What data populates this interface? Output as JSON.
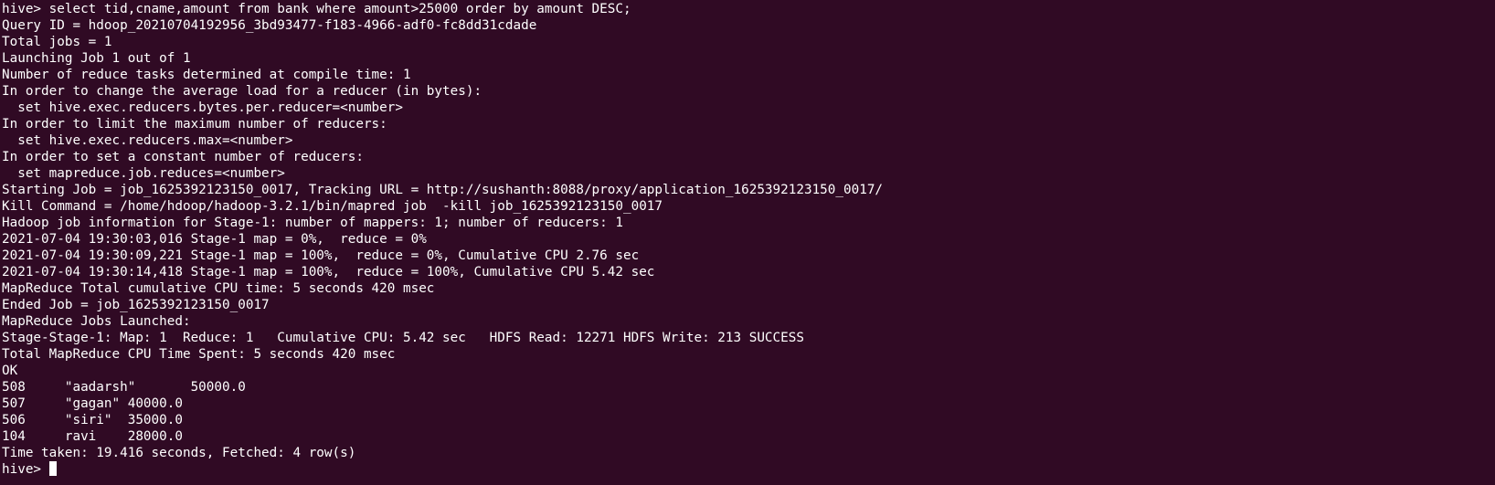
{
  "terminal": {
    "lines": [
      "hive> select tid,cname,amount from bank where amount>25000 order by amount DESC;",
      "Query ID = hdoop_20210704192956_3bd93477-f183-4966-adf0-fc8dd31cdade",
      "Total jobs = 1",
      "Launching Job 1 out of 1",
      "Number of reduce tasks determined at compile time: 1",
      "In order to change the average load for a reducer (in bytes):",
      "  set hive.exec.reducers.bytes.per.reducer=<number>",
      "In order to limit the maximum number of reducers:",
      "  set hive.exec.reducers.max=<number>",
      "In order to set a constant number of reducers:",
      "  set mapreduce.job.reduces=<number>",
      "Starting Job = job_1625392123150_0017, Tracking URL = http://sushanth:8088/proxy/application_1625392123150_0017/",
      "Kill Command = /home/hdoop/hadoop-3.2.1/bin/mapred job  -kill job_1625392123150_0017",
      "Hadoop job information for Stage-1: number of mappers: 1; number of reducers: 1",
      "2021-07-04 19:30:03,016 Stage-1 map = 0%,  reduce = 0%",
      "2021-07-04 19:30:09,221 Stage-1 map = 100%,  reduce = 0%, Cumulative CPU 2.76 sec",
      "2021-07-04 19:30:14,418 Stage-1 map = 100%,  reduce = 100%, Cumulative CPU 5.42 sec",
      "MapReduce Total cumulative CPU time: 5 seconds 420 msec",
      "Ended Job = job_1625392123150_0017",
      "MapReduce Jobs Launched:",
      "Stage-Stage-1: Map: 1  Reduce: 1   Cumulative CPU: 5.42 sec   HDFS Read: 12271 HDFS Write: 213 SUCCESS",
      "Total MapReduce CPU Time Spent: 5 seconds 420 msec",
      "OK",
      "508     \"aadarsh\"       50000.0",
      "507     \"gagan\" 40000.0",
      "506     \"siri\"  35000.0",
      "104     ravi    28000.0",
      "Time taken: 19.416 seconds, Fetched: 4 row(s)"
    ],
    "prompt": "hive> "
  },
  "colors": {
    "background": "#300a24",
    "foreground": "#ffffff"
  }
}
